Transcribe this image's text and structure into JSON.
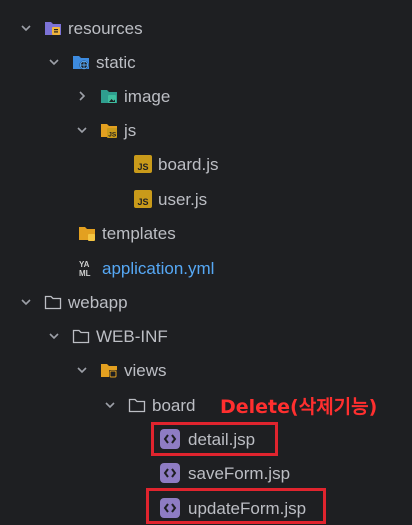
{
  "tree": {
    "resources": "resources",
    "static": "static",
    "image": "image",
    "js": "js",
    "board_js": "board.js",
    "user_js": "user.js",
    "templates": "templates",
    "application_yml": "application.yml",
    "webapp": "webapp",
    "web_inf": "WEB-INF",
    "views": "views",
    "board": "board",
    "detail_jsp": "detail.jsp",
    "saveform_jsp": "saveForm.jsp",
    "updateform_jsp": "updateForm.jsp"
  },
  "annotation": "Delete(삭제기능)",
  "colors": {
    "background": "#1e1f22",
    "text": "#bcbec4",
    "highlight": "#e0242e",
    "annotation": "#ff2f2f",
    "yml_label": "#56a8f5"
  }
}
